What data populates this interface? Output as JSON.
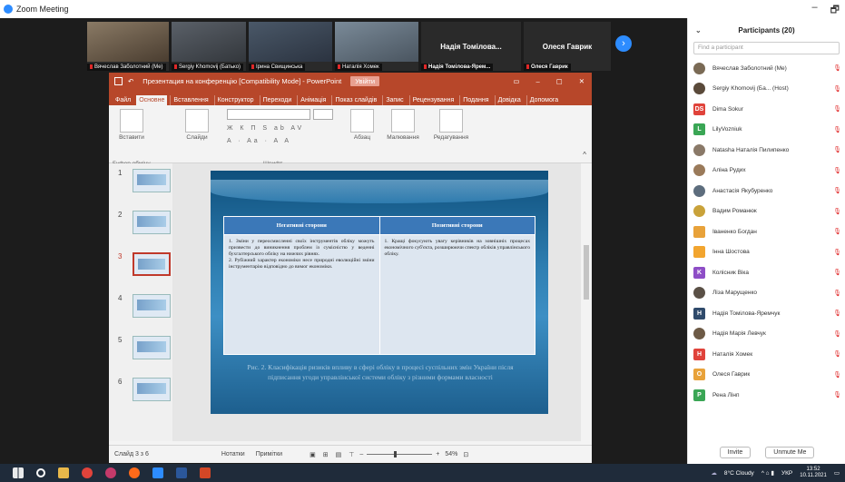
{
  "zoom": {
    "window_title": "Zoom Meeting",
    "controls": [
      "–",
      "🗗",
      "✕"
    ]
  },
  "video_strip": {
    "tiles": [
      {
        "name": "Вячеслав Заболотний (Ме)",
        "bg": "#6b5a48"
      },
      {
        "name": "Sergiy Khomovij (Батько)",
        "bg": "#4a4f55"
      },
      {
        "name": "Ірина Свищинська",
        "bg": "#3c4654"
      },
      {
        "name": "Наталія Хомек",
        "bg": "#5b6b78"
      },
      {
        "name": "Надія Томілова-Ярем...",
        "bg": "#2a2a2a"
      },
      {
        "name": "Олеся Гаврик",
        "bg": "#2a2a2a"
      }
    ],
    "text_tiles": [
      "Надія Томілова...",
      "Олеся Гаврик"
    ],
    "next_icon": "›"
  },
  "powerpoint": {
    "title": "Презентация на конференцію [Compatibility Mode] - PowerPoint",
    "signin": "Увійти",
    "tabs": [
      "Файл",
      "Основне",
      "Вставлення",
      "Конструктор",
      "Переходи",
      "Анімація",
      "Показ слайдів",
      "Запис",
      "Рецензування",
      "Подання",
      "Довідка",
      "Допомога"
    ],
    "ribbon": {
      "paste": "Вставити",
      "slides": "Слайди",
      "paragraph": "Абзац",
      "drawing": "Малювання",
      "editing": "Редагування",
      "clipboard_group": "Буфер обміну",
      "font_group": "Шрифт",
      "format_row": "Ж К П S ab AV",
      "format_row2": "A · Aa · A A"
    },
    "thumbnails": [
      "1",
      "2",
      "3",
      "4",
      "5",
      "6"
    ],
    "selected_slide": "3",
    "slide": {
      "col_left_header": "Негативні сторони",
      "col_right_header": "Позитивні сторони",
      "col_left_text": "1. Зміни у переосмисленні своїх інструментів обліку можуть призвести до виникнення проблем із сумісністю у веденні бухгалтерського обліку на нижчих рівнях.\n2. Рубіжний характер економіки несе природні еволюційні зміни інструментарію відповідно до вимог економіки.",
      "col_right_text": "1. Кращі фокусують увагу керівників на зовнішніх процесах економічного суб'єкта, розширюючи спектр обліків управлінського обліку.",
      "caption": "Рис. 2. Класифікація ризиків впливу в сфері обліку в процесі суспільних змін України після підписання угоди управлінської системи обліку з різними формами власності"
    },
    "status": {
      "slide_counter": "Слайд 3 з 6",
      "notes": "Нотатки",
      "comments": "Примітки",
      "zoom": "54%"
    }
  },
  "participants": {
    "title": "Participants (20)",
    "find_placeholder": "Find a participant",
    "list": [
      {
        "initials": "",
        "name": "Вячеслав Заболотний (Me)",
        "color": "#7a6a55",
        "photo": true
      },
      {
        "initials": "",
        "name": "Sergiy Khomovij (Ба... (Host)",
        "color": "#5a4a3a",
        "photo": true
      },
      {
        "initials": "DS",
        "name": "Dima Sokur",
        "color": "#e0433b"
      },
      {
        "initials": "L",
        "name": "LilyVozniuk",
        "color": "#3aa655"
      },
      {
        "initials": "",
        "name": "Natasha Наталія Пилипенко",
        "color": "#8a7968",
        "photo": true
      },
      {
        "initials": "",
        "name": "Аліна Рудих",
        "color": "#9a7a5a",
        "photo": true
      },
      {
        "initials": "",
        "name": "Анастасія Якубуренко",
        "color": "#5d6d7d",
        "photo": true
      },
      {
        "initials": "",
        "name": "Вадим Романюк",
        "color": "#c9a23a",
        "photo": true
      },
      {
        "initials": "",
        "name": "Іваненко Богдан",
        "color": "#e8a23a",
        "photo": false
      },
      {
        "initials": "",
        "name": "Інна Шостова",
        "color": "#f2a52f"
      },
      {
        "initials": "K",
        "name": "Колісник Віка",
        "color": "#8e4ec6"
      },
      {
        "initials": "",
        "name": "Ліза Марущенко",
        "color": "#5a5046",
        "photo": true
      },
      {
        "initials": "H",
        "name": "Надія Томілова-Яремчук",
        "color": "#2f4a6b"
      },
      {
        "initials": "",
        "name": "Надія Марія Левчук",
        "color": "#6d5a46",
        "photo": true
      },
      {
        "initials": "H",
        "name": "Наталія Хомек",
        "color": "#e0433b"
      },
      {
        "initials": "O",
        "name": "Олеся Гаврик",
        "color": "#e8a23a"
      },
      {
        "initials": "P",
        "name": "Рена Лінп",
        "color": "#3aa655"
      }
    ],
    "invite": "Invite",
    "unmute": "Unmute Me"
  },
  "taskbar": {
    "weather": "8°C Cloudy",
    "lang": "УКР",
    "time": "13:52",
    "date": "10.11.2021"
  }
}
